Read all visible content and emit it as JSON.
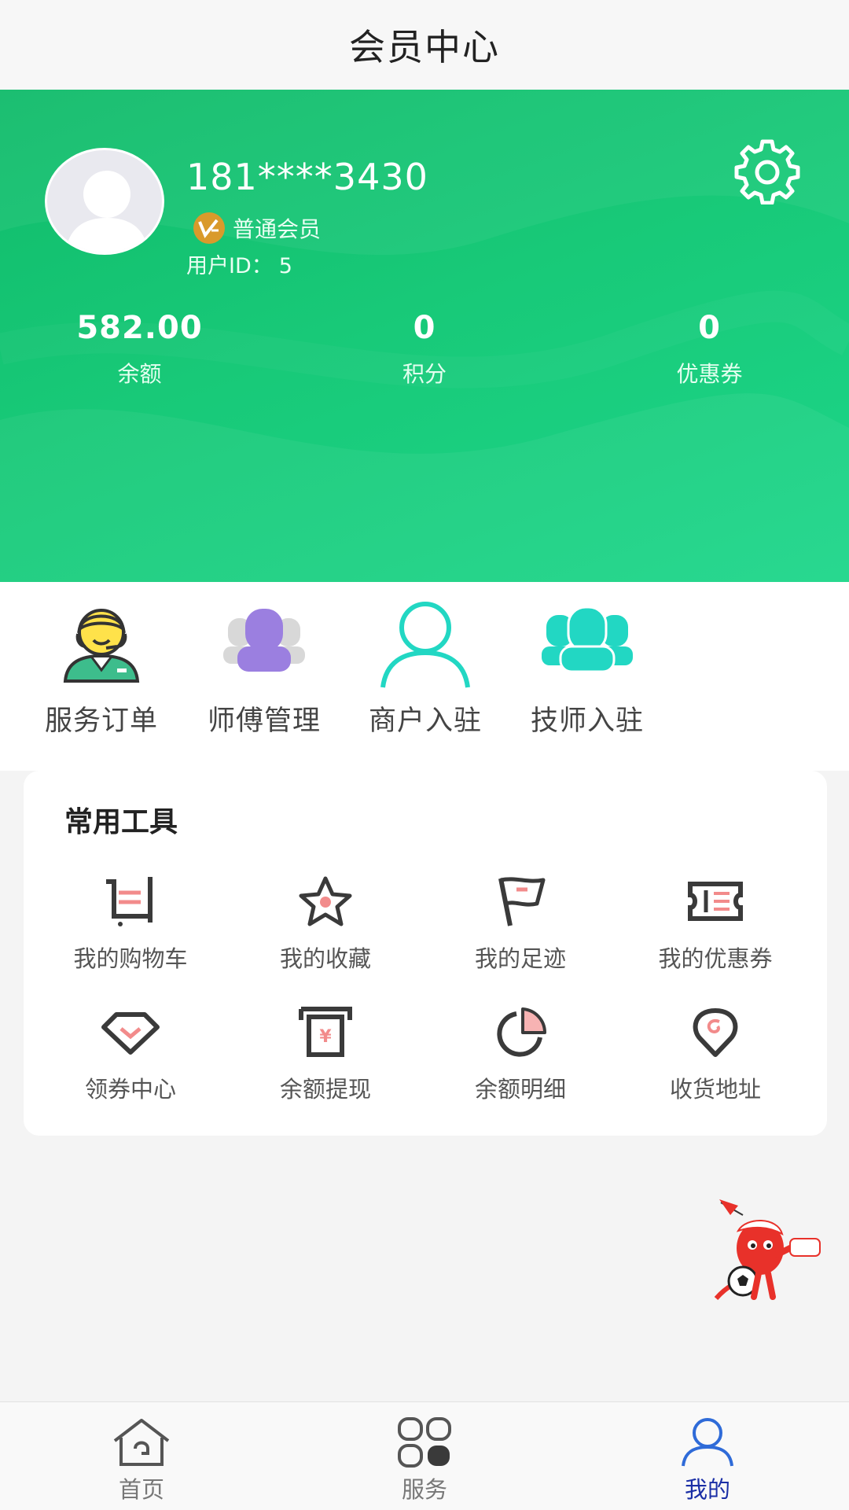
{
  "header": {
    "title": "会员中心"
  },
  "profile": {
    "phone": "181****3430",
    "level": "普通会员",
    "user_id_label": "用户ID：",
    "user_id": "5"
  },
  "stats": [
    {
      "value": "582.00",
      "label": "余额"
    },
    {
      "value": "0",
      "label": "积分"
    },
    {
      "value": "0",
      "label": "优惠券"
    }
  ],
  "shortcuts": [
    {
      "label": "服务订单",
      "icon": "service-agent-icon"
    },
    {
      "label": "师傅管理",
      "icon": "master-group-icon"
    },
    {
      "label": "商户入驻",
      "icon": "merchant-user-icon"
    },
    {
      "label": "技师入驻",
      "icon": "technician-group-icon"
    }
  ],
  "tools": {
    "title": "常用工具",
    "items": [
      {
        "label": "我的购物车",
        "icon": "cart-icon"
      },
      {
        "label": "我的收藏",
        "icon": "star-icon"
      },
      {
        "label": "我的足迹",
        "icon": "flag-icon"
      },
      {
        "label": "我的优惠券",
        "icon": "ticket-icon"
      },
      {
        "label": "领券中心",
        "icon": "diamond-icon"
      },
      {
        "label": "余额提现",
        "icon": "withdraw-icon"
      },
      {
        "label": "余额明细",
        "icon": "pie-chart-icon"
      },
      {
        "label": "收货地址",
        "icon": "location-icon"
      }
    ]
  },
  "tabbar": [
    {
      "label": "首页",
      "icon": "home-icon",
      "active": false
    },
    {
      "label": "服务",
      "icon": "grid-icon",
      "active": false
    },
    {
      "label": "我的",
      "icon": "user-icon",
      "active": true
    }
  ],
  "colors": {
    "primary_green": "#18c978",
    "accent_red": "#f28b8b",
    "active_tab": "#1b2fa6",
    "teal": "#22d7c3",
    "purple": "#9b7fe0"
  }
}
